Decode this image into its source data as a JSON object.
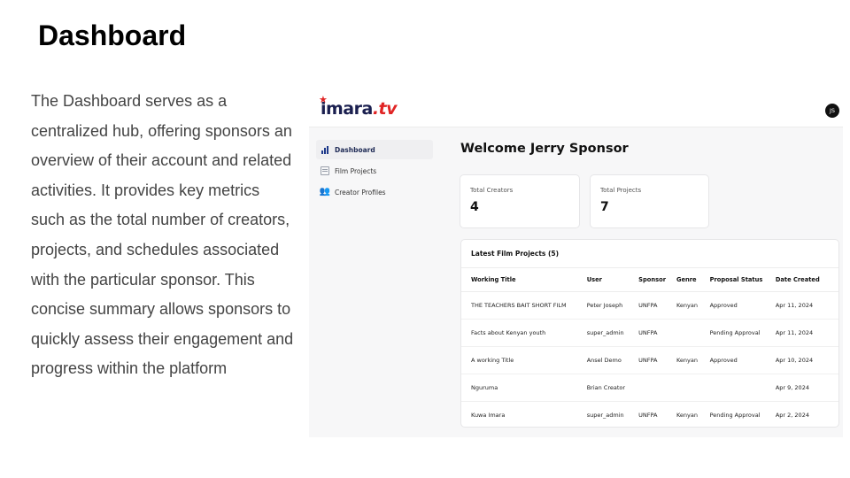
{
  "slide": {
    "title": "Dashboard",
    "body": "The Dashboard serves as a centralized hub, offering sponsors an overview of their account and related activities. It provides key metrics such as the total number of creators, projects, and schedules associated with the particular sponsor. This concise summary allows sponsors to quickly assess their engagement and progress within the platform"
  },
  "app": {
    "logo_main": "imara",
    "logo_dot": ".",
    "logo_tv": "tv",
    "user_initials": "JS",
    "brand_colors": {
      "navy": "#1a1f4f",
      "red": "#e02424"
    }
  },
  "sidebar": {
    "items": [
      {
        "label": "Dashboard",
        "icon": "bar-chart-icon",
        "active": true
      },
      {
        "label": "Film Projects",
        "icon": "film-icon",
        "active": false
      },
      {
        "label": "Creator Profiles",
        "icon": "users-icon",
        "active": false
      }
    ]
  },
  "main": {
    "welcome": "Welcome Jerry Sponsor",
    "stats": [
      {
        "label": "Total Creators",
        "value": "4"
      },
      {
        "label": "Total Projects",
        "value": "7"
      }
    ],
    "table": {
      "title": "Latest Film Projects (5)",
      "columns": [
        "Working Title",
        "User",
        "Sponsor",
        "Genre",
        "Proposal Status",
        "Date Created"
      ],
      "rows": [
        [
          "THE TEACHERS BAIT SHORT FILM",
          "Peter Joseph",
          "UNFPA",
          "Kenyan",
          "Approved",
          "Apr 11, 2024"
        ],
        [
          "Facts about Kenyan youth",
          "super_admin",
          "UNFPA",
          "",
          "Pending Approval",
          "Apr 11, 2024"
        ],
        [
          "A working Title",
          "Ansel Demo",
          "UNFPA",
          "Kenyan",
          "Approved",
          "Apr 10, 2024"
        ],
        [
          "Nguruma",
          "Brian Creator",
          "",
          "",
          "",
          "Apr 9, 2024"
        ],
        [
          "Kuwa Imara",
          "super_admin",
          "UNFPA",
          "Kenyan",
          "Pending Approval",
          "Apr 2, 2024"
        ]
      ]
    }
  }
}
